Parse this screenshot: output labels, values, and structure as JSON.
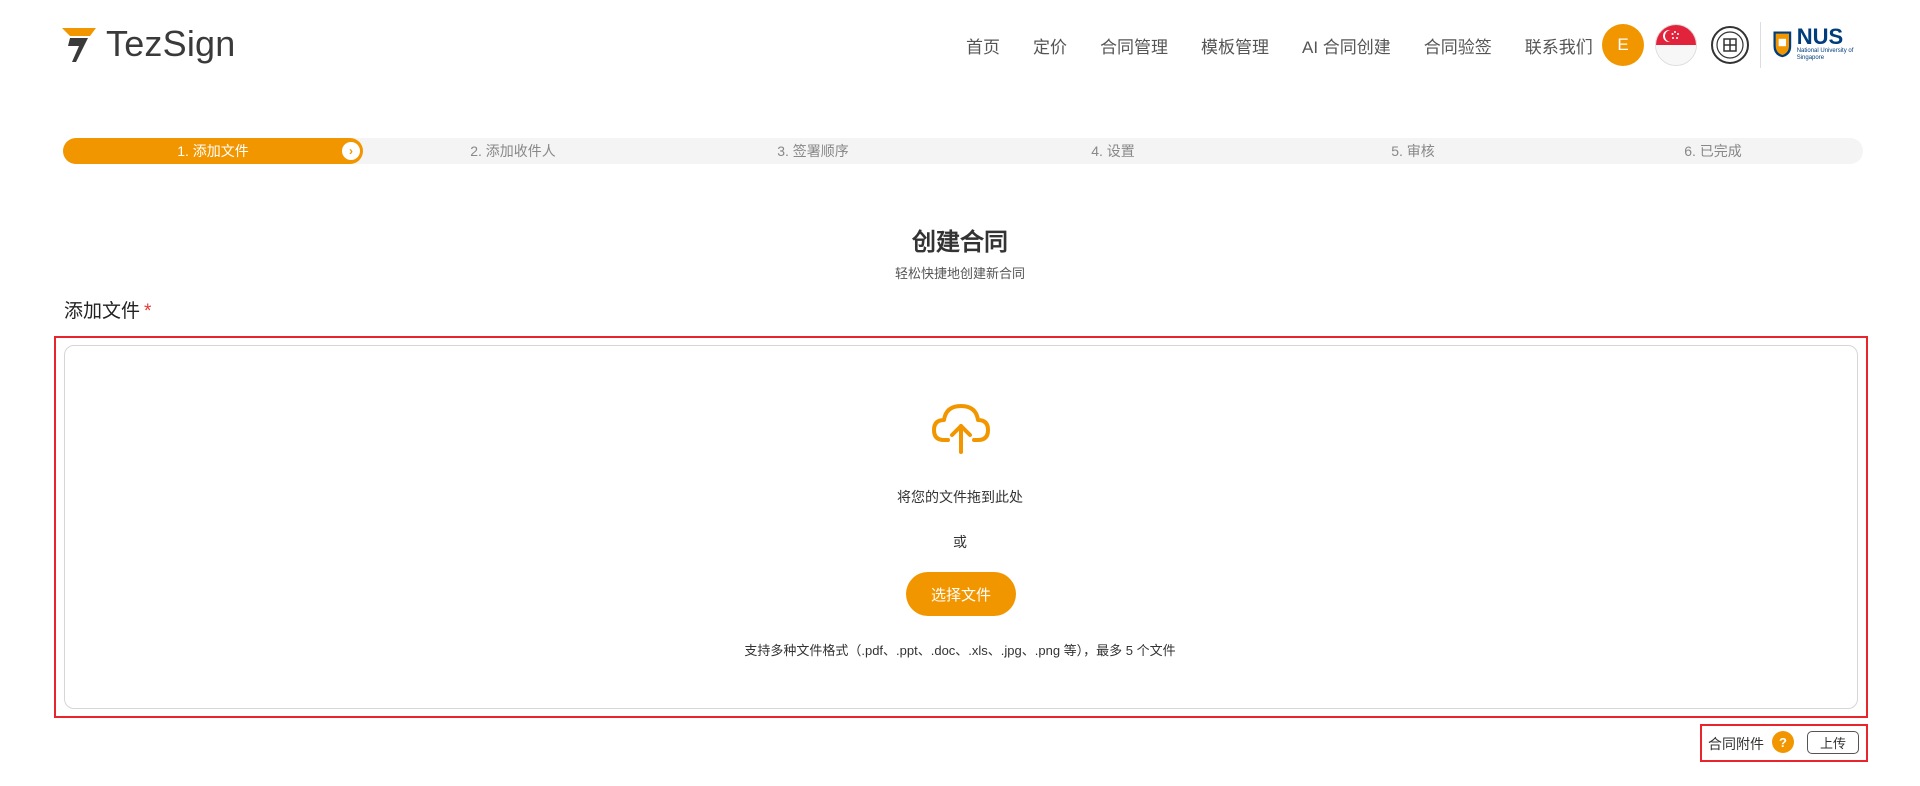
{
  "brand": {
    "name": "TezSign",
    "accent_color": "#f29600"
  },
  "nav": {
    "items": [
      "首页",
      "定价",
      "合同管理",
      "模板管理",
      "AI 合同创建",
      "合同验签",
      "联系我们"
    ]
  },
  "user": {
    "avatar_initial": "E"
  },
  "header_icons": [
    "singapore-flag-icon",
    "seal-icon",
    "nus-logo"
  ],
  "partner_logo": {
    "text": "NUS",
    "subtitle": "National University of Singapore"
  },
  "stepper": {
    "active_index": 0,
    "steps": [
      "1. 添加文件",
      "2. 添加收件人",
      "3. 签署顺序",
      "4. 设置",
      "5. 审核",
      "6. 已完成"
    ]
  },
  "page": {
    "title": "创建合同",
    "subtitle": "轻松快捷地创建新合同",
    "section_label": "添加文件",
    "required_mark": "*"
  },
  "upload": {
    "drag_text": "将您的文件拖到此处",
    "or_text": "或",
    "choose_button": "选择文件",
    "formats_text": "支持多种文件格式（.pdf、.ppt、.doc、.xls、.jpg、.png 等），最多 5 个文件"
  },
  "attachment": {
    "label": "合同附件",
    "help": "?",
    "upload_button": "上传"
  }
}
